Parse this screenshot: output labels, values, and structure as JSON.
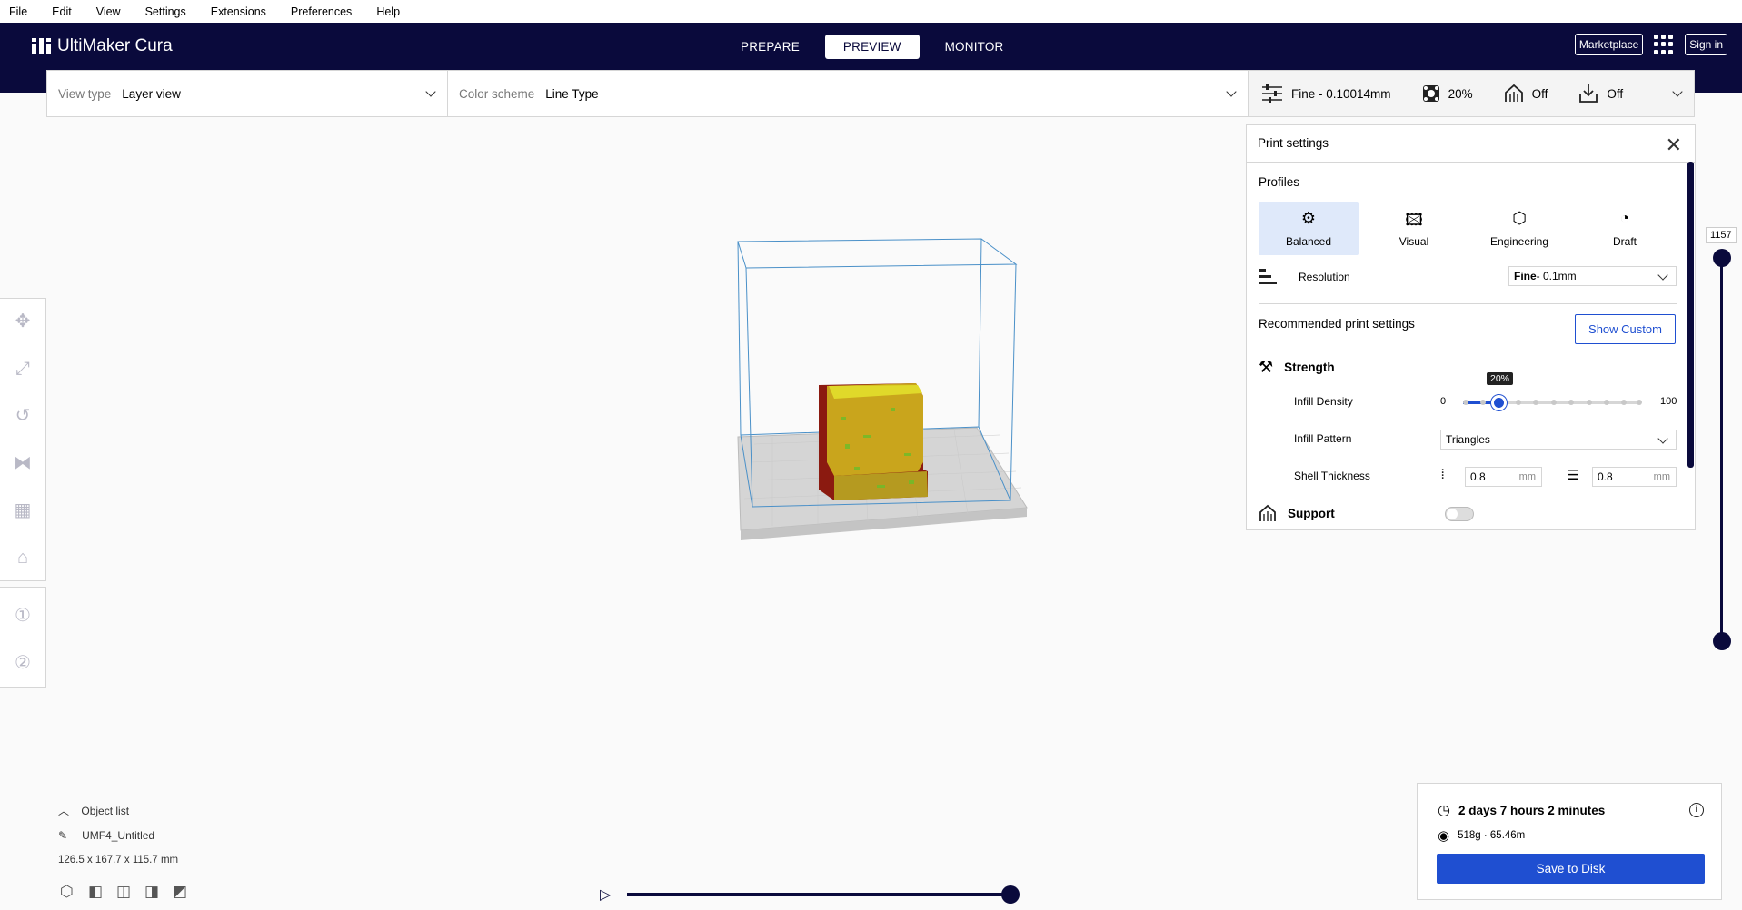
{
  "menu": [
    "File",
    "Edit",
    "View",
    "Settings",
    "Extensions",
    "Preferences",
    "Help"
  ],
  "header": {
    "app_name": "UltiMaker Cura",
    "stages": [
      "PREPARE",
      "PREVIEW",
      "MONITOR"
    ],
    "active_stage": "PREVIEW",
    "marketplace": "Marketplace",
    "sign_in": "Sign in"
  },
  "toolbar": {
    "view_type_label": "View type",
    "view_type_value": "Layer view",
    "color_scheme_label": "Color scheme",
    "color_scheme_value": "Line Type",
    "profile": "Fine - 0.10014mm",
    "infill": "20%",
    "support": "Off",
    "adhesion": "Off"
  },
  "print_settings": {
    "title": "Print settings",
    "profiles_label": "Profiles",
    "profiles": [
      {
        "label": "Balanced",
        "icon": "balanced-icon"
      },
      {
        "label": "Visual",
        "icon": "image-icon"
      },
      {
        "label": "Engineering",
        "icon": "engineering-icon"
      },
      {
        "label": "Draft",
        "icon": "gauge-icon"
      }
    ],
    "resolution_label": "Resolution",
    "resolution_bold": "Fine",
    "resolution_rest": " - 0.1mm",
    "recommended_label": "Recommended print settings",
    "show_custom": "Show Custom",
    "strength_label": "Strength",
    "infill_density_label": "Infill Density",
    "infill_min": "0",
    "infill_max": "100",
    "infill_tooltip": "20%",
    "infill_value": 20,
    "infill_pattern_label": "Infill Pattern",
    "infill_pattern_value": "Triangles",
    "shell_thickness_label": "Shell Thickness",
    "wall_thickness": "0.8",
    "top_bottom_thickness": "0.8",
    "unit": "mm",
    "support_label": "Support",
    "support_enabled": false
  },
  "layer_slider": {
    "value": "1157"
  },
  "object_list": {
    "label": "Object list",
    "name": "UMF4_Untitled",
    "dimensions": "126.5 x 167.7 x 115.7 mm"
  },
  "print_summary": {
    "time": "2 days 7 hours 2 minutes",
    "material": "518g · 65.46m",
    "save_button": "Save to Disk"
  },
  "colors": {
    "header_bg": "#0a0a3c",
    "accent": "#1f4fd1",
    "buildvolume": "#4a90c8"
  }
}
